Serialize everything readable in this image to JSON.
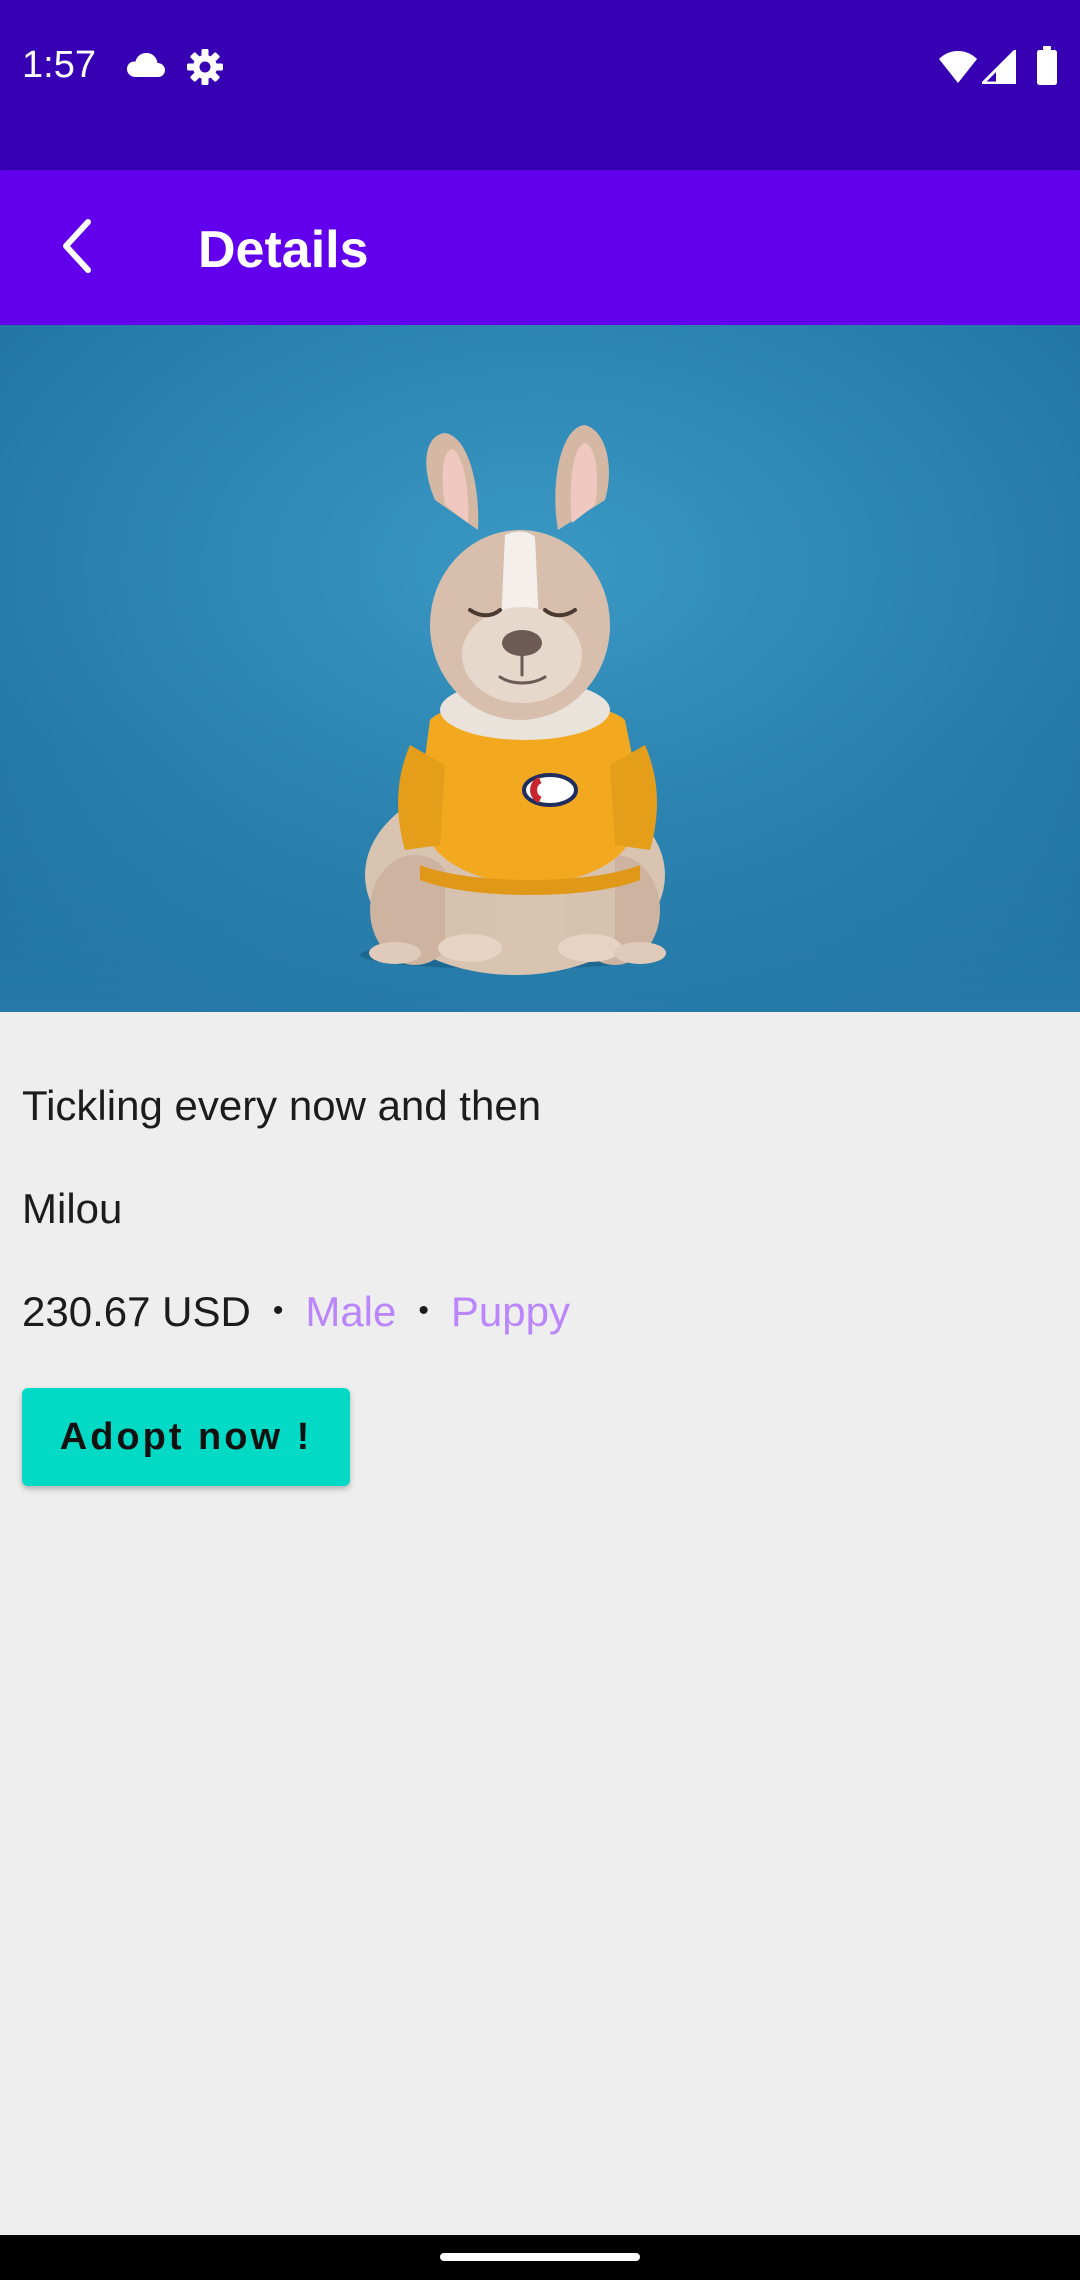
{
  "status_bar": {
    "time": "1:57",
    "left_icons": [
      "cloud-icon",
      "gear-icon"
    ],
    "right_icons": [
      "wifi-icon",
      "signal-icon",
      "battery-icon"
    ],
    "background": "#3700B3"
  },
  "app_bar": {
    "title": "Details",
    "back_icon": "chevron-left-icon",
    "background": "#6200EE"
  },
  "pet": {
    "photo": "french-bulldog-in-yellow-sweater",
    "description": "Tickling every now and then",
    "name": "Milou",
    "price": "230.67 USD",
    "separator": "•",
    "gender": "Male",
    "age": "Puppy"
  },
  "actions": {
    "adopt_label": "Adopt now !"
  },
  "colors": {
    "accent": "#BB86FC",
    "button": "#03DAC5",
    "background": "#EEEEEE"
  }
}
